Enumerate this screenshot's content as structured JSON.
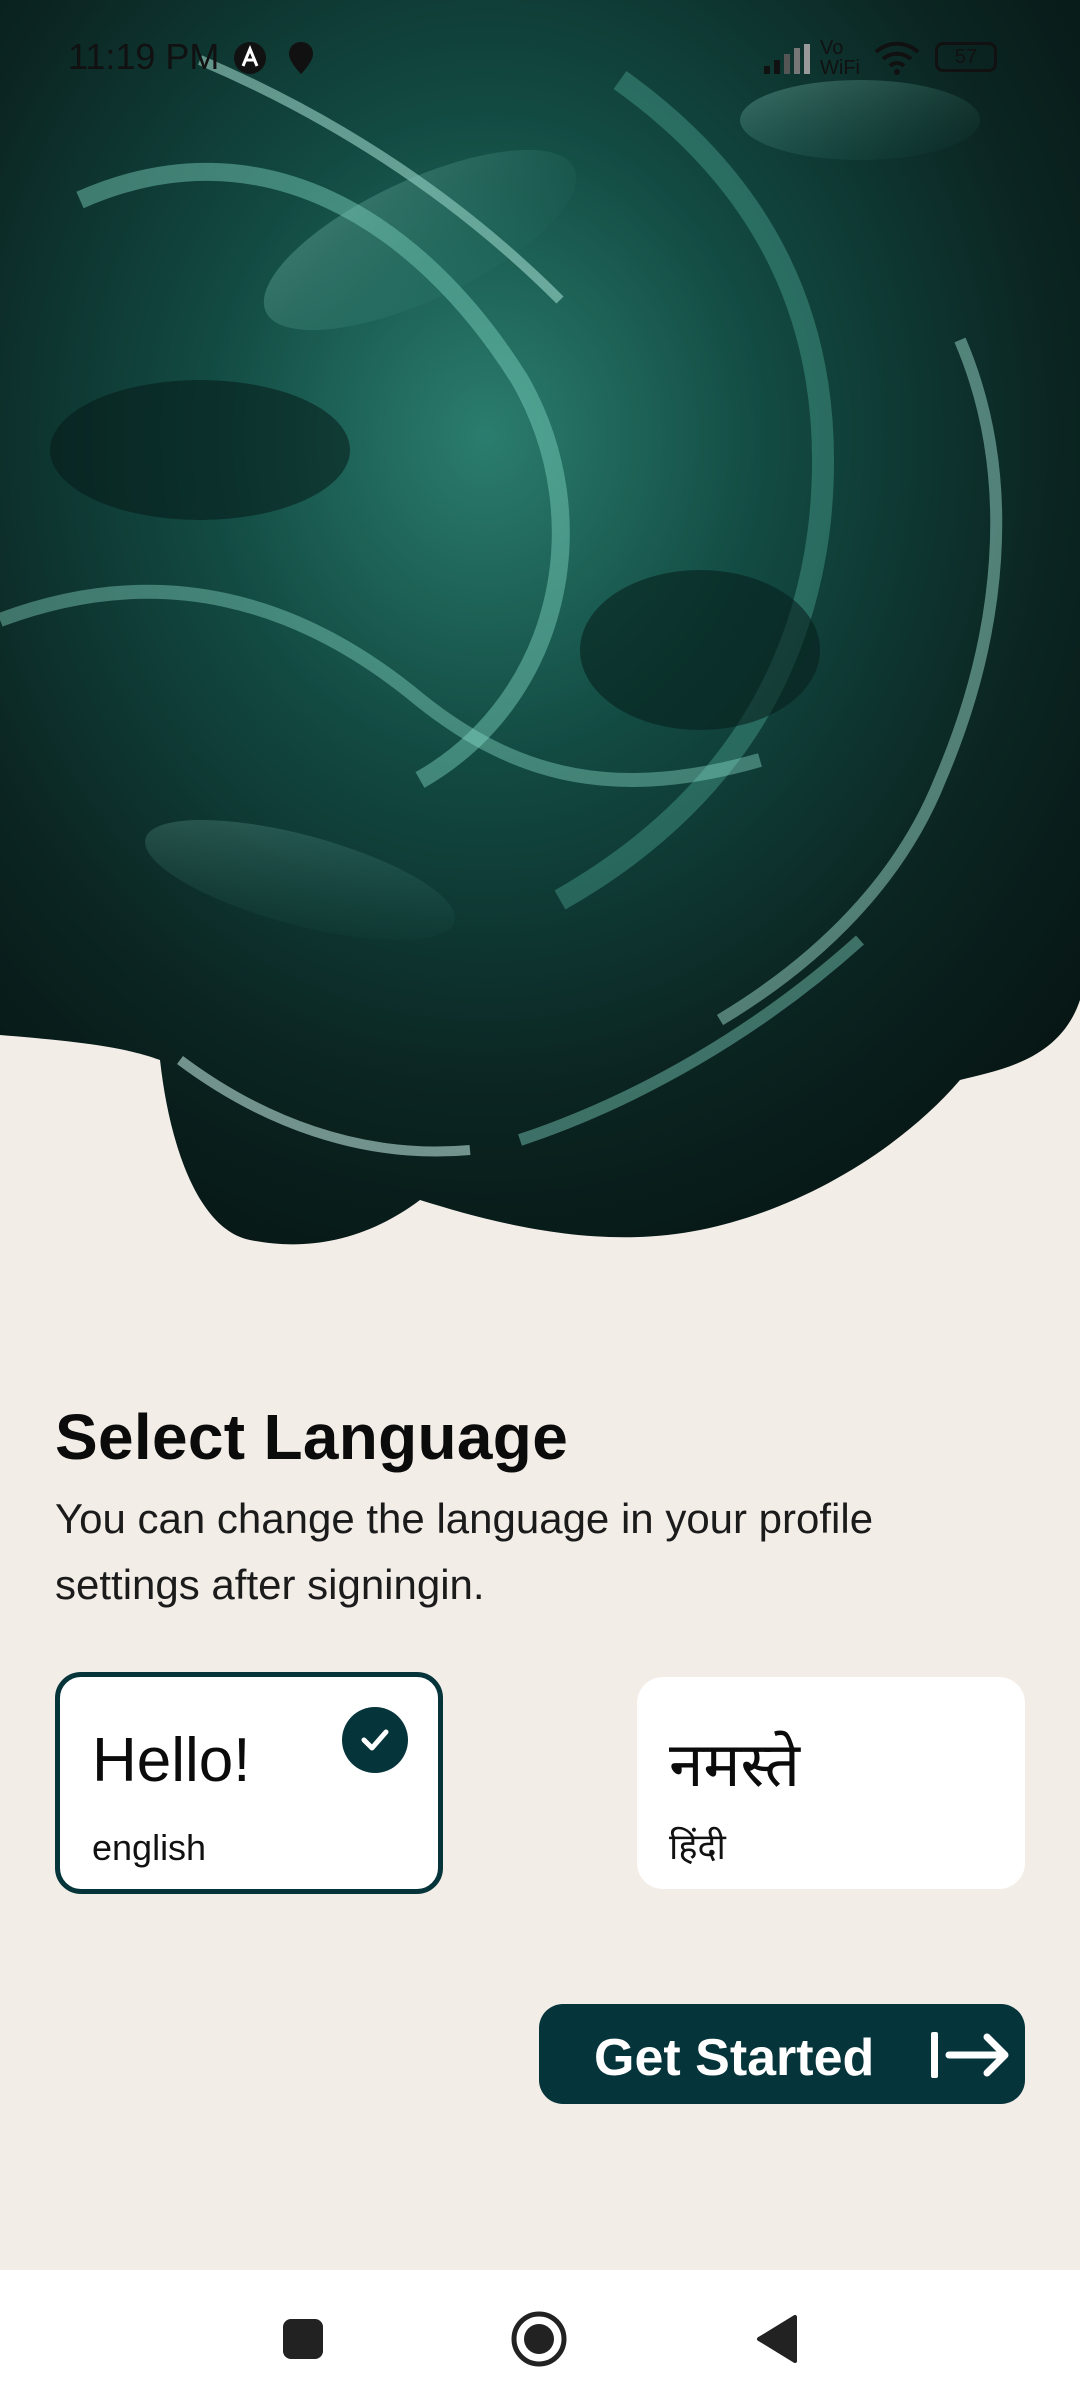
{
  "status_bar": {
    "time": "11:19 PM",
    "network_label_top": "Vo",
    "network_label_bottom": "WiFi",
    "battery": "57"
  },
  "language_screen": {
    "title": "Select Language",
    "subtitle": "You can change the language in your profile settings after signingin.",
    "options": [
      {
        "greeting": "Hello!",
        "language": "english",
        "selected": true
      },
      {
        "greeting": "नमस्ते",
        "language": "हिंदी",
        "selected": false
      }
    ],
    "cta_label": "Get Started"
  },
  "colors": {
    "background": "#f3ede8",
    "accent": "#05343a",
    "card": "#ffffff"
  },
  "icons": {
    "check": "check-icon",
    "arrow": "arrow-right-to-bar-icon",
    "nav_recent": "square-icon",
    "nav_home": "circle-icon",
    "nav_back": "triangle-back-icon"
  }
}
